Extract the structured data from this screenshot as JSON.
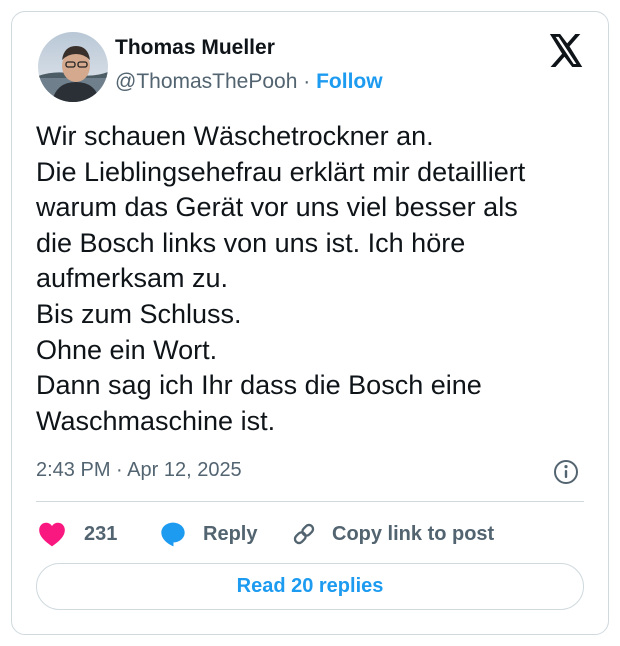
{
  "author": {
    "name": "Thomas Mueller",
    "handle": "@ThomasThePooh",
    "separator": "·",
    "follow_label": "Follow"
  },
  "post": {
    "lines": [
      "Wir schauen Wäschetrockner an.",
      "Die Lieblingsehefrau erklärt mir detailliert",
      "warum das Gerät vor uns viel besser als",
      "die Bosch links von uns ist. Ich höre",
      "aufmerksam zu.",
      "Bis zum Schluss.",
      "Ohne ein Wort.",
      "Dann sag ich Ihr dass die Bosch eine",
      "Waschmaschine ist."
    ],
    "timestamp": "2:43 PM · Apr 12, 2025"
  },
  "actions": {
    "like_count": "231",
    "reply_label": "Reply",
    "copy_label": "Copy link to post",
    "read_replies_label": "Read 20 replies"
  },
  "icons": {
    "brand": "x-logo-icon",
    "info": "info-icon",
    "like": "heart-icon",
    "reply": "speech-bubble-icon",
    "copy": "link-icon"
  },
  "colors": {
    "accent": "#1d9bf0",
    "like": "#f91880",
    "text": "#0f1419",
    "muted": "#536471",
    "border": "#cfd9de"
  }
}
